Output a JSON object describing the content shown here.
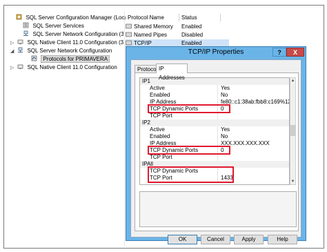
{
  "tree": {
    "items": [
      {
        "label": "SQL Server Configuration Manager (Local)",
        "icon": "server-config-icon",
        "expander": ""
      },
      {
        "label": "SQL Server Services",
        "icon": "services-icon",
        "expander": ""
      },
      {
        "label": "SQL Server Network Configuration (32bit",
        "icon": "network-icon",
        "expander": ""
      },
      {
        "label": "SQL Native Client 11.0 Configuration (32b",
        "icon": "client-icon",
        "expander": "▷"
      },
      {
        "label": "SQL Server Network Configuration",
        "icon": "network-icon",
        "expander": "◢"
      },
      {
        "label": "Protocols for PRIMAVERA",
        "icon": "protocols-icon",
        "expander": ""
      },
      {
        "label": "SQL Native Client 11.0 Configuration",
        "icon": "client-icon",
        "expander": "▷"
      }
    ]
  },
  "list": {
    "columns": [
      "Protocol Name",
      "Status"
    ],
    "rows": [
      {
        "name": "Shared Memory",
        "status": "Enabled"
      },
      {
        "name": "Named Pipes",
        "status": "Disabled"
      },
      {
        "name": "TCP/IP",
        "status": "Enabled"
      }
    ]
  },
  "dialog": {
    "title": "TCP/IP Properties",
    "help_glyph": "?",
    "close_glyph": "X",
    "tabs": [
      "Protocol",
      "IP Addresses"
    ],
    "grid": [
      {
        "type": "group",
        "key": "IP1",
        "value": ""
      },
      {
        "type": "row",
        "key": "Active",
        "value": "Yes"
      },
      {
        "type": "row",
        "key": "Enabled",
        "value": "No"
      },
      {
        "type": "row",
        "key": "IP Address",
        "value": "fe80::c1:38ab:fbb8:c169%12"
      },
      {
        "type": "row",
        "key": "TCP Dynamic Ports",
        "value": "0"
      },
      {
        "type": "row",
        "key": "TCP Port",
        "value": ""
      },
      {
        "type": "group",
        "key": "IP2",
        "value": ""
      },
      {
        "type": "row",
        "key": "Active",
        "value": "Yes"
      },
      {
        "type": "row",
        "key": "Enabled",
        "value": "No"
      },
      {
        "type": "row",
        "key": "IP Address",
        "value": "XXX.XXX.XXX.XXX"
      },
      {
        "type": "row",
        "key": "TCP Dynamic Ports",
        "value": "0"
      },
      {
        "type": "row",
        "key": "TCP Port",
        "value": ""
      },
      {
        "type": "group",
        "key": "IPAll",
        "value": ""
      },
      {
        "type": "row",
        "key": "TCP Dynamic Ports",
        "value": ""
      },
      {
        "type": "row",
        "key": "TCP Port",
        "value": "1433"
      }
    ],
    "buttons": {
      "ok": "OK",
      "cancel": "Cancel",
      "apply": "Apply",
      "help": "Help"
    }
  },
  "colors": {
    "highlight": "#e0182f",
    "titlebar": "#6ab4e7",
    "close": "#c74a4a"
  }
}
